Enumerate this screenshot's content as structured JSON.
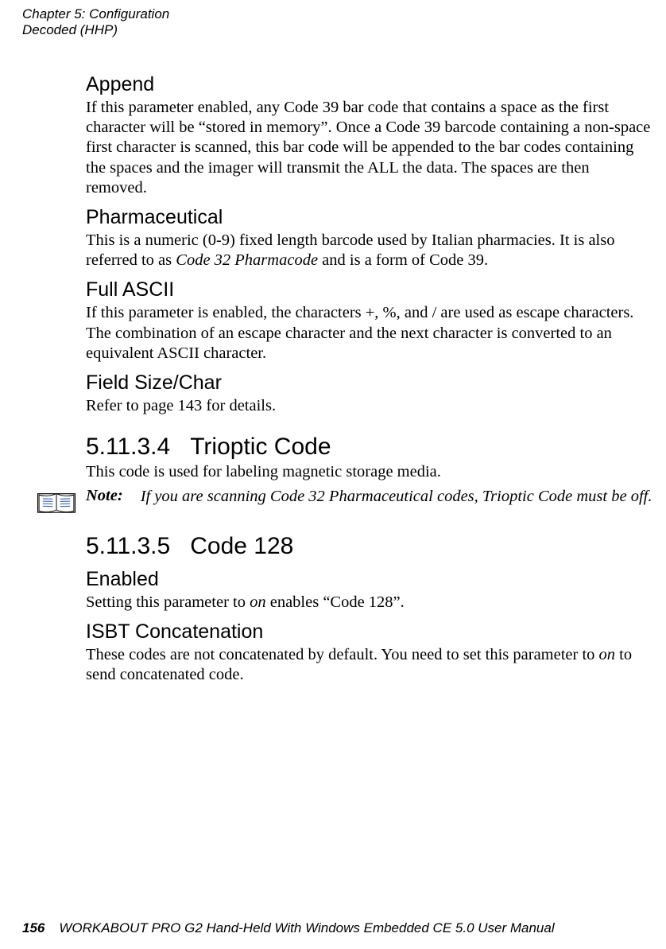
{
  "running_head": {
    "line1": "Chapter 5: Configuration",
    "line2": "Decoded (HHP)"
  },
  "sections": {
    "append": {
      "title": "Append",
      "body": "If this parameter enabled, any Code 39 bar code that contains a space as the first character will be “stored in memory”. Once a Code 39 barcode containing a non-space first character is scanned, this bar code will be appended to the bar codes containing the spaces and the imager will transmit the ALL the data. The spaces are then removed."
    },
    "pharmaceutical": {
      "title": "Pharmaceutical",
      "body_pre": "This is a numeric (0-9) fixed length barcode used by Italian pharmacies. It is also referred to as ",
      "body_ital": "Code 32 Pharmacode",
      "body_post": " and is a form of Code 39."
    },
    "full_ascii": {
      "title": "Full ASCII",
      "body": "If this parameter is enabled, the characters +, %, and / are used as escape characters. The combination of an escape character and the next character is converted to an equivalent ASCII character."
    },
    "field_size": {
      "title": "Field Size/Char",
      "body": "Refer to page 143 for details."
    },
    "trioptic": {
      "number": "5.11.3.4",
      "title": "Trioptic Code",
      "body": "This code is used for labeling magnetic storage media.",
      "note_label": "Note:",
      "note_text": "If you are scanning Code 32 Pharmaceutical codes, Trioptic Code must be off."
    },
    "code128": {
      "number": "5.11.3.5",
      "title": "Code 128",
      "enabled_title": "Enabled",
      "enabled_pre": "Setting this parameter to ",
      "enabled_ital": "on",
      "enabled_post": " enables “Code 128”.",
      "isbt_title": "ISBT Concatenation",
      "isbt_pre": "These codes are not concatenated by default. You need to set this parameter to ",
      "isbt_ital": "on",
      "isbt_post": " to send concatenated code."
    }
  },
  "footer": {
    "page_number": "156",
    "book_title": "WORKABOUT PRO G2 Hand-Held With Windows Embedded CE 5.0 User Manual"
  }
}
